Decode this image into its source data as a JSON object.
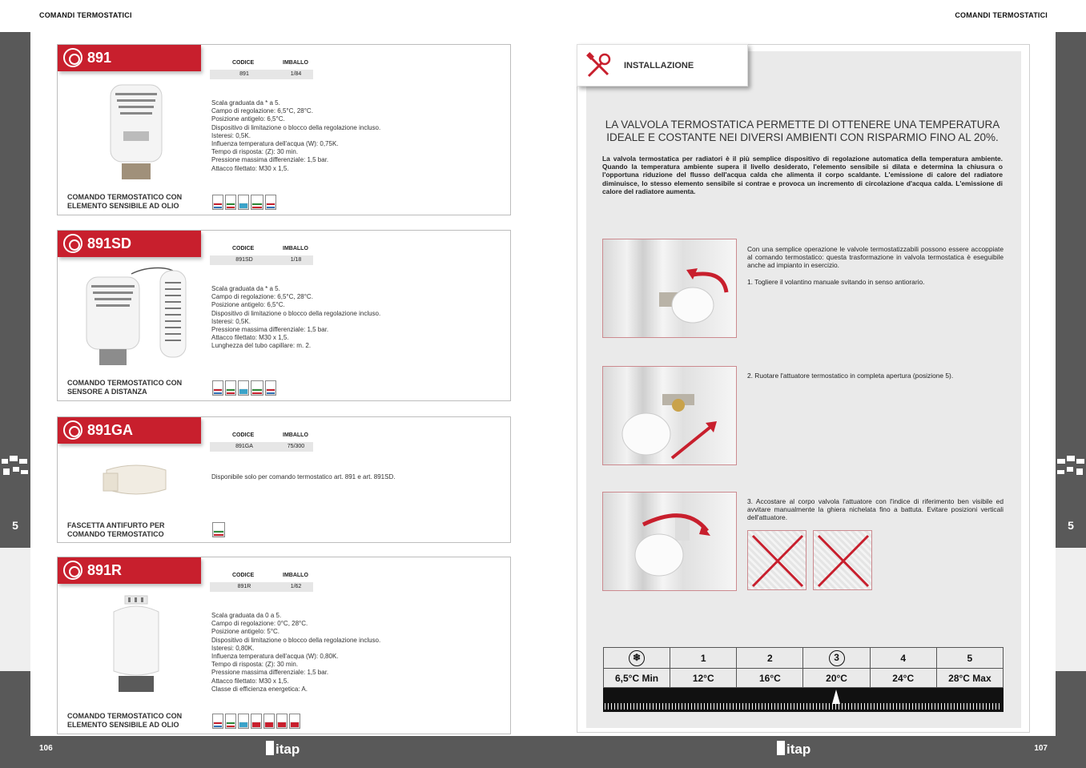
{
  "header": {
    "left": "COMANDI TERMOSTATICI",
    "right": "COMANDI TERMOSTATICI"
  },
  "section_number": {
    "left": "5",
    "right": "5"
  },
  "footer": {
    "page_left": "106",
    "page_right": "107"
  },
  "logo_text": "itap",
  "products": [
    {
      "code": "891",
      "col_codice": "CODICE",
      "col_imballo": "IMBALLO",
      "codice": "891",
      "imballo": "1/84",
      "specs": "Scala graduata da * a 5.\nCampo di regolazione: 6,5°C, 28°C.\nPosizione antigelo: 6,5°C.\nDispositivo di limitazione o blocco della regolazione incluso.\nIsteresi: 0,5K.\nInfluenza temperatura dell'acqua (W): 0,75K.\nTempo di risposta: (Z): 30 min.\nPressione massima differenziale: 1,5 bar.\nAttacco filettato: M30 x 1,5.",
      "name": "COMANDO TERMOSTATICO CON ELEMENTO SENSIBILE AD OLIO"
    },
    {
      "code": "891SD",
      "col_codice": "CODICE",
      "col_imballo": "IMBALLO",
      "codice": "891SD",
      "imballo": "1/18",
      "specs": "Scala graduata da * a 5.\nCampo di regolazione: 6,5°C, 28°C.\nPosizione antigelo: 6,5°C.\nDispositivo di limitazione o blocco della regolazione incluso.\nIsteresi: 0,5K.\nPressione massima differenziale: 1,5 bar.\nAttacco filettato: M30 x 1,5.\nLunghezza del tubo capillare: m. 2.",
      "name": "COMANDO TERMOSTATICO CON SENSORE A DISTANZA"
    },
    {
      "code": "891GA",
      "col_codice": "CODICE",
      "col_imballo": "IMBALLO",
      "codice": "891GA",
      "imballo": "75/300",
      "specs": "Disponibile solo per comando termostatico art. 891 e art. 891SD.",
      "name": "FASCETTA ANTIFURTO PER COMANDO TERMOSTATICO"
    },
    {
      "code": "891R",
      "col_codice": "CODICE",
      "col_imballo": "IMBALLO",
      "codice": "891R",
      "imballo": "1/62",
      "specs": "Scala graduata da 0 a 5.\nCampo di regolazione: 0°C, 28°C.\nPosizione antigelo: 5°C.\nDispositivo di limitazione o blocco della regolazione incluso.\nIsteresi: 0,80K.\nInfluenza temperatura dell'acqua (W): 0,80K.\nTempo di risposta: (Z): 30 min.\nPressione massima differenziale: 1,5 bar.\nAttacco filettato: M30 x 1,5.\nClasse di efficienza energetica: A.",
      "name": "COMANDO TERMOSTATICO CON ELEMENTO SENSIBILE AD OLIO"
    }
  ],
  "installation": {
    "tag": "INSTALLAZIONE",
    "headline": "LA VALVOLA TERMOSTATICA PERMETTE DI OTTENERE UNA TEMPERATURA IDEALE E COSTANTE NEI DIVERSI AMBIENTI CON RISPARMIO FINO AL 20%.",
    "intro": "La valvola termostatica per radiatori è il più semplice dispositivo di regolazione automatica della temperatura ambiente. Quando la temperatura ambiente supera il livello desiderato, l'elemento sensibile si dilata e determina la chiusura o l'opportuna riduzione del flusso dell'acqua calda che alimenta il corpo scaldante. L'emissione di calore del radiatore diminuisce, lo stesso elemento sensibile si contrae e provoca un incremento di circolazione d'acqua calda. L'emissione di calore del radiatore aumenta.",
    "step1_a": "Con una semplice operazione le valvole termostatizzabili possono essere accoppiate al comando termostatico: questa trasformazione in valvola termostatica è eseguibile anche ad impianto in esercizio.",
    "step1_b": "1. Togliere il volantino manuale svitando in senso antiorario.",
    "step2": "2. Ruotare l'attuatore termostatico in completa apertura (posizione 5).",
    "step3": "3. Accostare al corpo valvola l'attuatore con l'indice di riferimento ben visibile ed avvitare manualmente la ghiera nichelata fino a battuta. Evitare posizioni verticali dell'attuatore."
  },
  "scale": {
    "positions": [
      "1",
      "2",
      "3",
      "4",
      "5"
    ],
    "temps": [
      "6,5°C Min",
      "12°C",
      "16°C",
      "20°C",
      "24°C",
      "28°C Max"
    ],
    "icon": "snowflake-icon"
  },
  "colors": {
    "accent": "#c81f2d",
    "band": "#595959"
  }
}
